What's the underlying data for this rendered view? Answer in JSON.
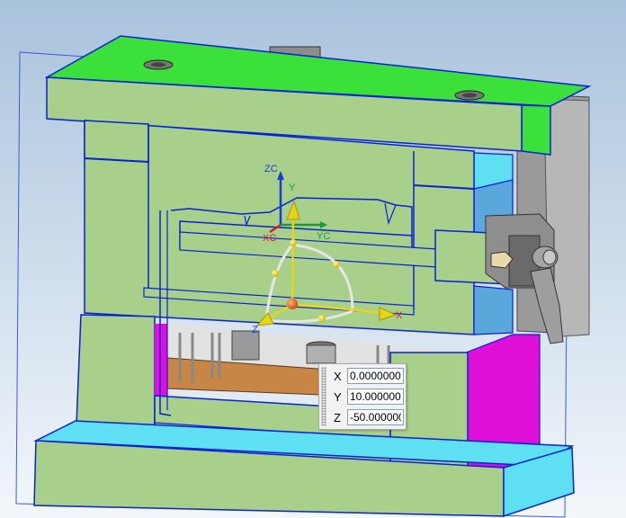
{
  "viewport": {
    "background_top": "#a9c3dc",
    "background_bottom": "#f3f7fb",
    "colors": {
      "plate_green": "#a8d08a",
      "top_face_green": "#3be03b",
      "edge_blue": "#0a1fd6",
      "cyan": "#5ee0f2",
      "side_blue": "#5aa7dc",
      "magenta": "#e010d8",
      "ejector_orange": "#c88646",
      "gray_metal": "#8e8e8e"
    }
  },
  "csys": {
    "zc_label": "ZC",
    "xc_label": "XC",
    "yc_label": "YC"
  },
  "manipulator": {
    "y_label": "Y",
    "z_label": "Z",
    "x_label": "X",
    "colors": {
      "y": "#e8d51a",
      "handle": "#e85d1a",
      "arc": "#e6e6e6"
    }
  },
  "coord_panel": {
    "x_label": "X",
    "x_value": "0.0000000",
    "y_label": "Y",
    "y_value": "10.0000000",
    "z_label": "Z",
    "z_value": "-50.0000000"
  }
}
